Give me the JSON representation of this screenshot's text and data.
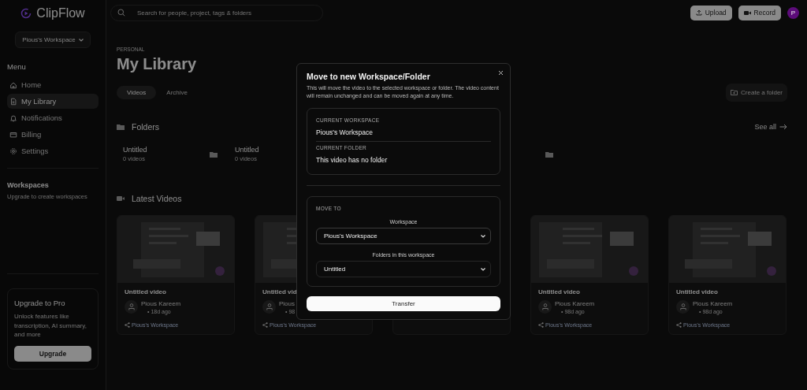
{
  "app": {
    "name": "ClipFlow"
  },
  "search": {
    "placeholder": "Search for people, project, tags & folders"
  },
  "header_buttons": [
    {
      "kind": "upload",
      "label": "Upload"
    },
    {
      "kind": "record",
      "label": "Record"
    }
  ],
  "avatar": {
    "initial": "P",
    "color": "#5c0c7a"
  },
  "sidebar": {
    "workspace": "Pious's Workspace",
    "menu_title": "Menu",
    "items": [
      {
        "label": "Home",
        "selected": false
      },
      {
        "label": "My Library",
        "selected": true
      },
      {
        "label": "Notifications",
        "selected": false
      },
      {
        "label": "Billing",
        "selected": false
      },
      {
        "label": "Settings",
        "selected": false
      }
    ],
    "workspaces_title": "Workspaces",
    "workspaces_hint": "Upgrade to create workspaces",
    "upgrade": {
      "title": "Upgrade to Pro",
      "text": "Unlock features like transcription, AI summary, and more",
      "button": "Upgrade"
    }
  },
  "main": {
    "eyebrow": "PERSONAL",
    "title": "My Library",
    "tabs": [
      {
        "label": "Videos",
        "selected": true
      },
      {
        "label": "Archive",
        "selected": false
      }
    ],
    "create_folder": "Create a folder",
    "folders_title": "Folders",
    "see_all": "See all",
    "folders": [
      {
        "kind": "shown",
        "name": "Untitled",
        "count": "0 videos"
      },
      {
        "kind": "text_only",
        "name": "Untitled",
        "count": "0 videos"
      },
      {
        "kind": "covered"
      },
      {
        "kind": "icon_only"
      }
    ],
    "videos_title": "Latest Videos",
    "videos": [
      {
        "kind": "shown",
        "title": "Untitled video",
        "author": "Pious Kareem",
        "age": "• 18d ago",
        "workspace": "Pious's Workspace"
      },
      {
        "kind": "shown",
        "title": "Untitled vid",
        "author": "Pious",
        "age": "• 98",
        "workspace": "Pious's Workspace"
      },
      {
        "kind": "covered"
      },
      {
        "kind": "shown",
        "title": "Untitled video",
        "author": "Pious Kareem",
        "age": "• 98d ago",
        "workspace": "Pious's Workspace"
      },
      {
        "kind": "shown",
        "title": "Untitled video",
        "author": "Pious Kareem",
        "age": "• 98d ago",
        "workspace": "Pious's Workspace"
      }
    ]
  },
  "modal": {
    "title": "Move to new Workspace/Folder",
    "description": "This will move the video to the selected workspace or folder. The video content will remain unchanged and can be moved again at any time.",
    "current_workspace_label": "CURRENT WORKSPACE",
    "current_workspace": "Pious's Workspace",
    "current_folder_label": "CURRENT FOLDER",
    "current_folder": "This video has no folder",
    "move_to_label": "MOVE TO",
    "workspace_label": "Workspace",
    "workspace_value": "Pious's Workspace",
    "folder_label": "Folders in this workspace",
    "folder_value": "Untitled",
    "button": "Transfer"
  }
}
